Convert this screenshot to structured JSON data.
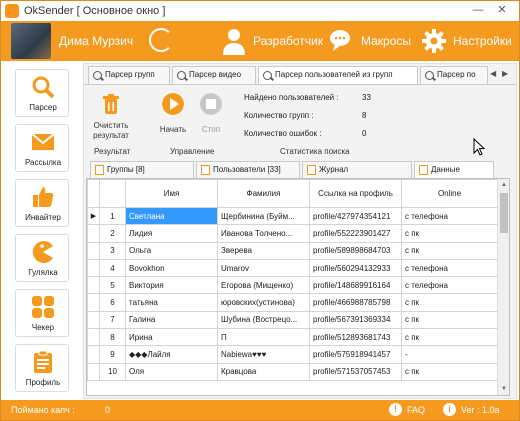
{
  "window": {
    "title": "OkSender [ Основное окно ]",
    "minimize": "—",
    "close": "✕"
  },
  "header": {
    "user_name": "Дима Мурзич",
    "developer_label": "Разработчик",
    "macros_label": "Макросы",
    "settings_label": "Настройки"
  },
  "sidebar": {
    "items": [
      {
        "label": "Парсер",
        "icon": "search-icon"
      },
      {
        "label": "Рассылка",
        "icon": "envelope-icon"
      },
      {
        "label": "Инвайтер",
        "icon": "thumbs-up-icon"
      },
      {
        "label": "Гулялка",
        "icon": "pacman-icon"
      },
      {
        "label": "Чекер",
        "icon": "grid-icon"
      },
      {
        "label": "Профиль",
        "icon": "clipboard-icon"
      }
    ]
  },
  "tabs": [
    {
      "label": "Парсер групп"
    },
    {
      "label": "Парсер видео"
    },
    {
      "label": "Парсер пользователей из групп"
    },
    {
      "label": "Парсер по"
    }
  ],
  "toolbar": {
    "clear_label": "Очистить результат",
    "start_label": "Начать",
    "stop_label": "Стоп",
    "group_result": "Результат",
    "group_control": "Управление",
    "group_stats": "Статистика поиска"
  },
  "stats": {
    "found_label": "Найдено пользователей :",
    "found_value": "33",
    "groups_label": "Количество групп :",
    "groups_value": "8",
    "errors_label": "Количество ошибок :",
    "errors_value": "0"
  },
  "subtabs": [
    {
      "label": "Группы [8]"
    },
    {
      "label": "Пользователи [33]"
    },
    {
      "label": "Журнал"
    },
    {
      "label": "Данные"
    }
  ],
  "table": {
    "columns": [
      "Имя",
      "Фамилия",
      "Ссылка на профиль",
      "Online"
    ],
    "rows": [
      {
        "n": "1",
        "name": "Светлана",
        "surname": "Щербинина (Буйм...",
        "link": "profile/427974354121",
        "online": "с телефона"
      },
      {
        "n": "2",
        "name": "Лидия",
        "surname": "Иванова Толчено...",
        "link": "profile/552223901427",
        "online": "с пк"
      },
      {
        "n": "3",
        "name": "Ольга",
        "surname": "Зверева",
        "link": "profile/589898684703",
        "online": "с пк"
      },
      {
        "n": "4",
        "name": "Bovokhon",
        "surname": "Umarov",
        "link": "profile/560294132933",
        "online": "с телефона"
      },
      {
        "n": "5",
        "name": "Виктория",
        "surname": "Егорова (Мищенко)",
        "link": "profile/148689916164",
        "online": "с телефона"
      },
      {
        "n": "6",
        "name": "татьяна",
        "surname": "юровских(устинова)",
        "link": "profile/466988785798",
        "online": "с пк"
      },
      {
        "n": "7",
        "name": "Галина",
        "surname": "Шубина (Вострецо...",
        "link": "profile/567391369334",
        "online": "с пк"
      },
      {
        "n": "8",
        "name": "Ирина",
        "surname": "П",
        "link": "profile/512893681743",
        "online": "с пк"
      },
      {
        "n": "9",
        "name": "◆◆◆Лайля",
        "surname": "Nabiewa♥♥♥",
        "link": "profile/575918941457",
        "online": "-"
      },
      {
        "n": "10",
        "name": "Оля",
        "surname": "Кравцова",
        "link": "profile/571537057453",
        "online": "с пк"
      }
    ]
  },
  "statusbar": {
    "captcha_label": "Поймано капч :",
    "captcha_value": "0",
    "faq_label": "FAQ",
    "version_label": "Ver : 1.0a"
  },
  "colors": {
    "accent": "#f39a1f",
    "selection": "#3399ff"
  }
}
